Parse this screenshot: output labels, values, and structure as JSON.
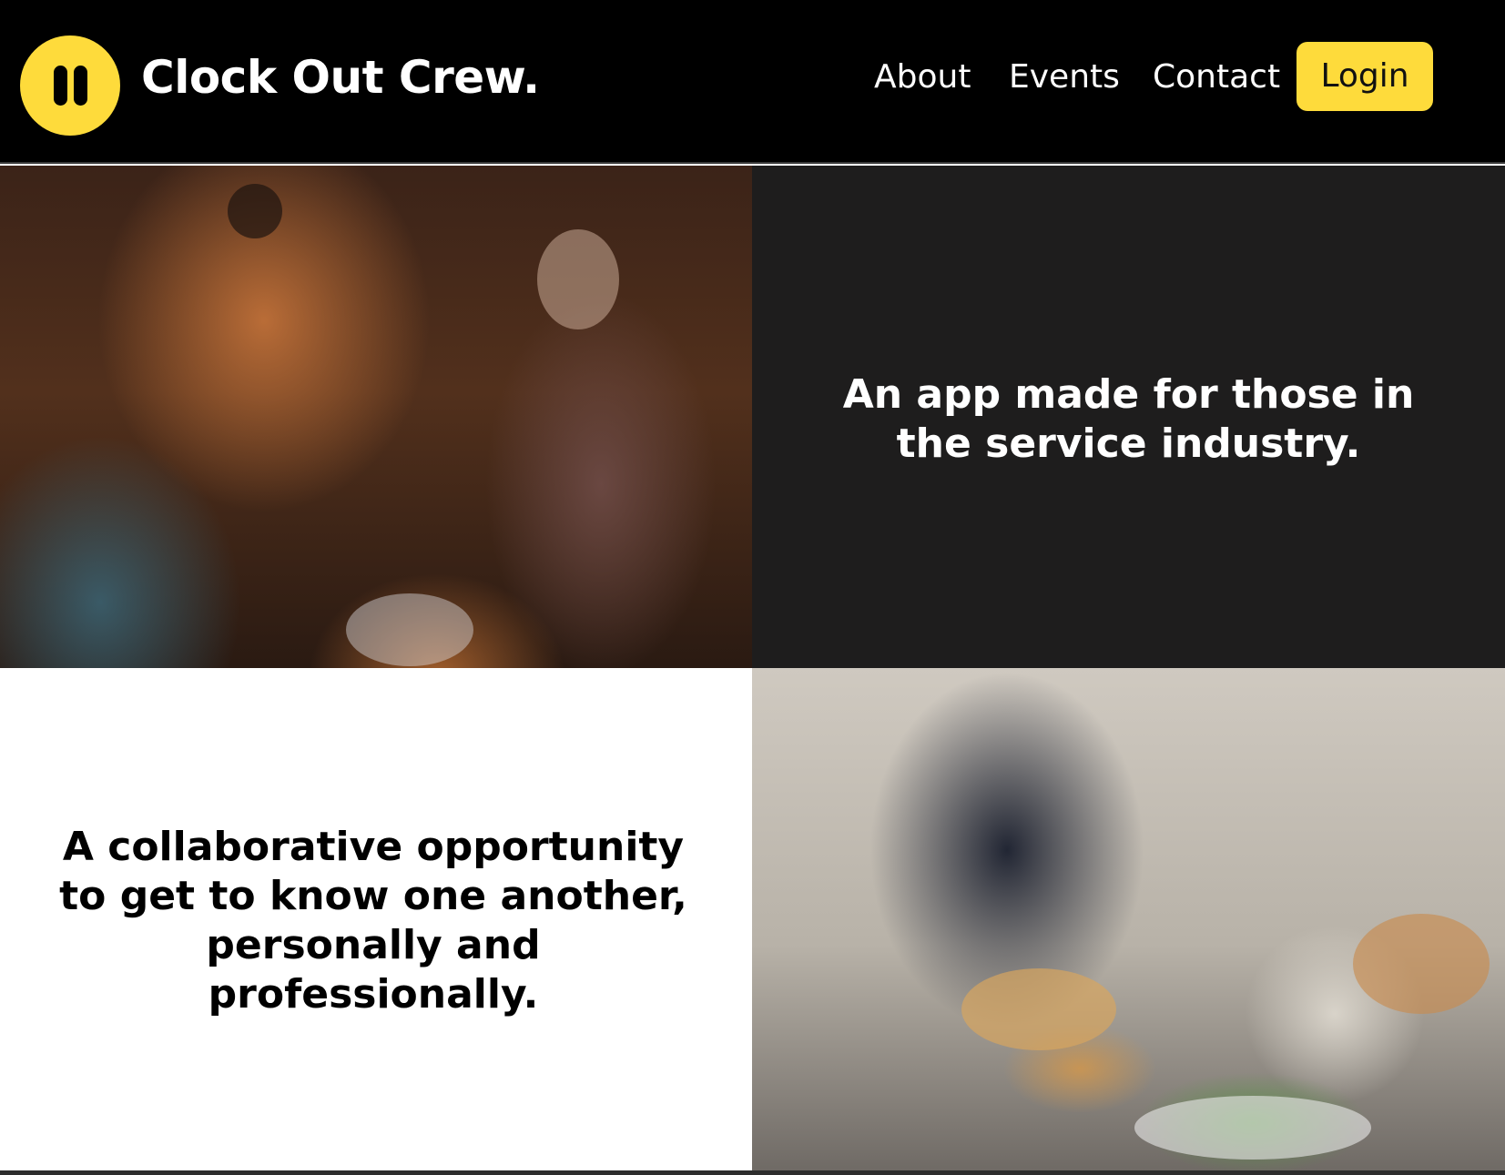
{
  "header": {
    "brand": "Clock Out Crew.",
    "logo_icon": "pause-icon",
    "nav": {
      "about": "About",
      "events": "Events",
      "contact": "Contact"
    },
    "login_label": "Login",
    "accent_color": "#fedb3b",
    "background_color": "#000000"
  },
  "sections": {
    "intro": {
      "line1": "An app made for those in",
      "line2": "the service industry."
    },
    "collab": {
      "line1": "A collaborative opportunity",
      "line2": "to get to know one another,",
      "line3": "personally and",
      "line4": "professionally."
    }
  },
  "colors": {
    "dark_panel": "#1e1d1d",
    "light_panel": "#ffffff"
  }
}
